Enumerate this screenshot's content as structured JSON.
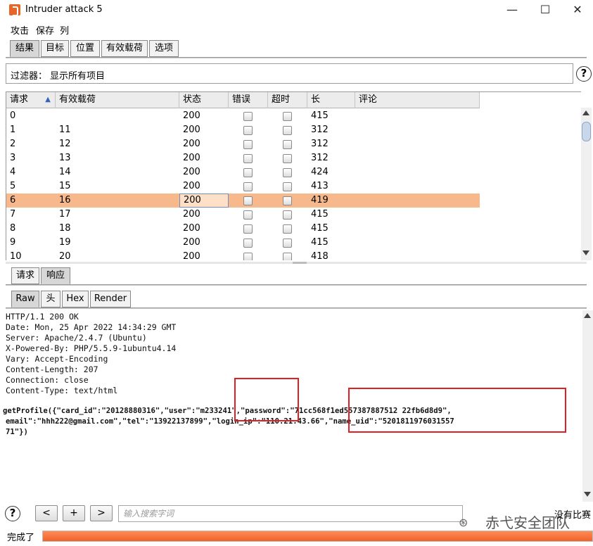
{
  "window": {
    "title": "Intruder attack 5",
    "minimize": "—",
    "maximize": "☐",
    "close": "✕"
  },
  "menu": [
    "攻击",
    "保存",
    "列"
  ],
  "top_tabs": [
    {
      "label": "结果",
      "active": true
    },
    {
      "label": "目标",
      "active": false
    },
    {
      "label": "位置",
      "active": false
    },
    {
      "label": "有效载荷",
      "active": false
    },
    {
      "label": "选项",
      "active": false
    }
  ],
  "filter": {
    "label": "过滤器：",
    "value": "显示所有项目",
    "help": "?"
  },
  "table": {
    "columns": [
      "请求",
      "有效载荷",
      "状态",
      "错误",
      "超时",
      "长",
      "评论"
    ],
    "sort_indicator": "▲",
    "rows": [
      {
        "request": "0",
        "payload": "",
        "status": "200",
        "length": "415",
        "selected": false
      },
      {
        "request": "1",
        "payload": "11",
        "status": "200",
        "length": "312",
        "selected": false
      },
      {
        "request": "2",
        "payload": "12",
        "status": "200",
        "length": "312",
        "selected": false
      },
      {
        "request": "3",
        "payload": "13",
        "status": "200",
        "length": "312",
        "selected": false
      },
      {
        "request": "4",
        "payload": "14",
        "status": "200",
        "length": "424",
        "selected": false
      },
      {
        "request": "5",
        "payload": "15",
        "status": "200",
        "length": "413",
        "selected": false
      },
      {
        "request": "6",
        "payload": "16",
        "status": "200",
        "length": "419",
        "selected": true
      },
      {
        "request": "7",
        "payload": "17",
        "status": "200",
        "length": "415",
        "selected": false
      },
      {
        "request": "8",
        "payload": "18",
        "status": "200",
        "length": "415",
        "selected": false
      },
      {
        "request": "9",
        "payload": "19",
        "status": "200",
        "length": "415",
        "selected": false
      },
      {
        "request": "10",
        "payload": "20",
        "status": "200",
        "length": "418",
        "selected": false
      }
    ]
  },
  "req_tabs": [
    {
      "label": "请求",
      "active": false
    },
    {
      "label": "响应",
      "active": true
    }
  ],
  "view_tabs": [
    {
      "label": "Raw",
      "active": true
    },
    {
      "label": "头",
      "active": false
    },
    {
      "label": "Hex",
      "active": false
    },
    {
      "label": "Render",
      "active": false
    }
  ],
  "response": {
    "lines": [
      "HTTP/1.1 200 OK",
      "Date: Mon, 25 Apr 2022 14:34:29 GMT",
      "Server: Apache/2.4.7 (Ubuntu)",
      "X-Powered-By: PHP/5.5.9-1ubuntu4.14",
      "Vary: Accept-Encoding",
      "Content-Length: 207",
      "Connection: close",
      "Content-Type: text/html",
      "",
      "getProfile({\"card_id\":\"20128880316\",\"user\":\"m233241\",\"password\":\"71cc568f1ed557387887512 22fb6d8d9\",",
      "email\":\"hhh222@gmail.com\",\"tel\":\"13922137899\",\"login_ip\":\"110.21.43.66\",\"name_uid\":\"5201811976031557",
      "71\"})"
    ]
  },
  "bottom": {
    "help": "?",
    "prev": "<",
    "add": "+",
    "next": ">",
    "search_placeholder": "输入搜索字词",
    "watermark": "赤弋安全团队",
    "watermark_icon": "⊛",
    "matches": "没有比赛"
  },
  "status": {
    "text": "完成了",
    "progress": 1.0
  },
  "colors": {
    "selected_row": "#f7b98c",
    "progress": "#f0632a",
    "highlight_box": "#e02020"
  }
}
